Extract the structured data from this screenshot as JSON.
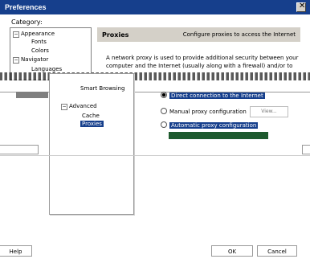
{
  "window": {
    "title": "Preferences",
    "close_glyph": "✕"
  },
  "category": {
    "label": "Category:"
  },
  "tree": [
    {
      "label": "Appearance",
      "expander": "−"
    },
    {
      "label": "Fonts"
    },
    {
      "label": "Colors"
    },
    {
      "label": "Navigator",
      "expander": "−"
    },
    {
      "label": "Languages"
    }
  ],
  "panel": {
    "heading": "Proxies",
    "subheading": "Configure proxies to access the Internet",
    "description": "A network proxy is used to provide additional security between your computer and the Internet (usually along with a firewall) and/or to"
  },
  "overlay_list": [
    {
      "label": "Smart Browsing"
    },
    {
      "label": "Advanced",
      "expander": "−"
    },
    {
      "label": "Cache"
    },
    {
      "label": "Proxies",
      "selected": true
    }
  ],
  "proxy_options": [
    {
      "label": "Direct connection to the Internet",
      "checked": true
    },
    {
      "label": "Manual proxy configuration",
      "checked": false,
      "button": "View..."
    },
    {
      "label": "Automatic proxy configuration",
      "checked": false
    }
  ],
  "buttons": {
    "ok": "OK",
    "cancel": "Cancel",
    "help": "Help"
  },
  "colors": {
    "titlebar": "#163f8c",
    "selection": "#163f8c",
    "panel": "#d4d0c8"
  }
}
